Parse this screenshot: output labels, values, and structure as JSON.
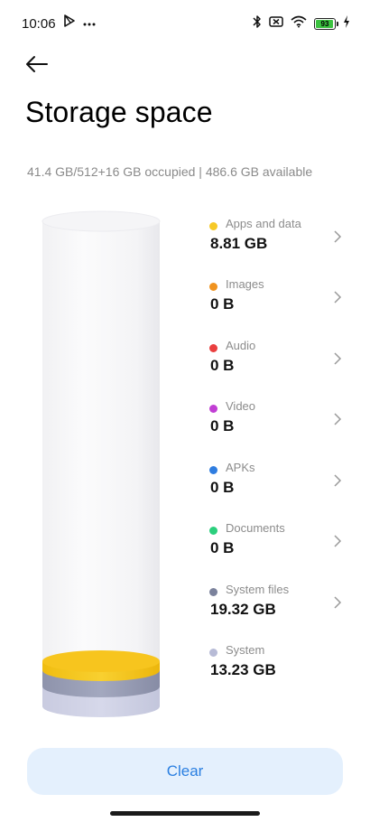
{
  "status_bar": {
    "time": "10:06",
    "battery": "93",
    "battery_level": 0.93,
    "icons_left": [
      "play-store-icon",
      "more-dots-icon"
    ],
    "icons_right": [
      "bluetooth-icon",
      "no-sim-icon",
      "wifi-icon",
      "battery-icon",
      "charging-icon"
    ]
  },
  "header": {
    "title": "Storage space"
  },
  "summary": "41.4 GB/512+16 GB occupied | 486.6 GB available",
  "categories": [
    {
      "name": "Apps and data",
      "size": "8.81 GB",
      "color": "#f6c928"
    },
    {
      "name": "Images",
      "size": "0 B",
      "color": "#f0931f"
    },
    {
      "name": "Audio",
      "size": "0 B",
      "color": "#ea3f3f"
    },
    {
      "name": "Video",
      "size": "0 B",
      "color": "#c13ed4"
    },
    {
      "name": "APKs",
      "size": "0 B",
      "color": "#2f7de0"
    },
    {
      "name": "Documents",
      "size": "0 B",
      "color": "#2bcf7d"
    },
    {
      "name": "System files",
      "size": "19.32 GB",
      "color": "#7b829c"
    },
    {
      "name": "System",
      "size": "13.23 GB",
      "color": "#b7bbd6"
    }
  ],
  "clear_button": "Clear"
}
